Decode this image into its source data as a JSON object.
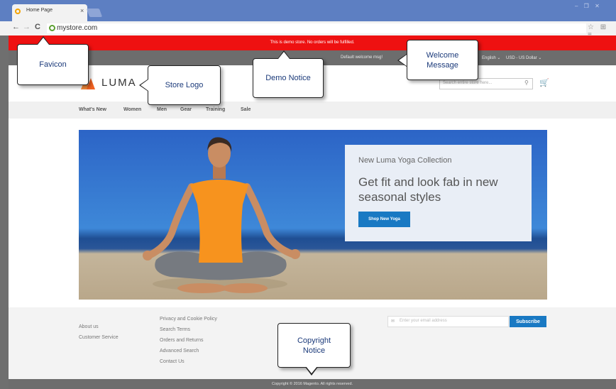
{
  "browser": {
    "tab_title": "Home Page",
    "tab_close": "×",
    "url": "mystore.com",
    "nav_back": "←",
    "nav_forward": "→",
    "nav_reload": "C",
    "window_controls": "– ❐ ✕",
    "toolbar_icons": "☆ ⊞ ≡"
  },
  "store": {
    "demo_notice": "This is demo store. No orders will be fulfilled.",
    "welcome": "Default welcome msg!",
    "language": "English ⌄",
    "currency": "USD - US Dollar ⌄",
    "logo_text": "LUMA",
    "search_placeholder": "Search entire store here...",
    "search_icon": "⚲",
    "cart_icon": "🛒",
    "nav": [
      "What's New",
      "Women",
      "Men",
      "Gear",
      "Training",
      "Sale"
    ],
    "promo": {
      "subtitle": "New Luma Yoga Collection",
      "title": "Get fit and look fab in new seasonal styles",
      "button": "Shop New Yoga"
    },
    "footer": {
      "col1": [
        "About us",
        "Customer Service"
      ],
      "col2": [
        "Privacy and Cookie Policy",
        "Search Terms",
        "Orders and Returns",
        "Advanced Search",
        "Contact Us"
      ],
      "newsletter_placeholder": "Enter your email address",
      "newsletter_icon": "✉",
      "subscribe": "Subscribe"
    },
    "copyright": "Copyright © 2016 Magento. All rights reserved."
  },
  "callouts": {
    "favicon": "Favicon",
    "store_logo": "Store Logo",
    "demo_notice": "Demo Notice",
    "welcome_message": "Welcome Message",
    "copyright_notice": "Copyright Notice"
  },
  "colors": {
    "demo_bar": "#ee1111",
    "accent_blue": "#1979c3",
    "panel_gray": "#6d6d6d",
    "logo_orange": "#f26322"
  }
}
